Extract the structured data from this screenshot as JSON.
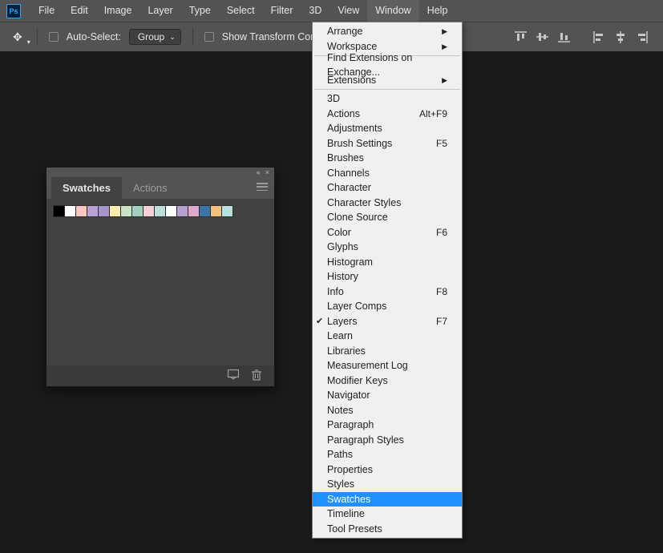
{
  "menubar": {
    "logo": "Ps",
    "items": [
      "File",
      "Edit",
      "Image",
      "Layer",
      "Type",
      "Select",
      "Filter",
      "3D",
      "View",
      "Window",
      "Help"
    ]
  },
  "optionsbar": {
    "auto_select_label": "Auto-Select:",
    "group_label": "Group",
    "show_transform_label": "Show Transform Contro"
  },
  "panel": {
    "collapse_glyph": "«",
    "close_glyph": "×",
    "tabs": [
      "Swatches",
      "Actions"
    ],
    "swatch_colors": [
      "#000000",
      "#ffffff",
      "#f7c7c0",
      "#b9a3d6",
      "#a694cf",
      "#fcecb0",
      "#c8e3c5",
      "#a2cfc2",
      "#f6cfd9",
      "#b8e0d6",
      "#ffffff",
      "#b6a0d3",
      "#dfa7c9",
      "#3b74a8",
      "#f1c27d",
      "#b5e2de"
    ]
  },
  "window_menu": {
    "items": [
      {
        "label": "Arrange",
        "submenu": true
      },
      {
        "label": "Workspace",
        "submenu": true
      },
      {
        "sep": true
      },
      {
        "label": "Find Extensions on Exchange..."
      },
      {
        "label": "Extensions",
        "submenu": true
      },
      {
        "sep": true
      },
      {
        "label": "3D"
      },
      {
        "label": "Actions",
        "shortcut": "Alt+F9"
      },
      {
        "label": "Adjustments"
      },
      {
        "label": "Brush Settings",
        "shortcut": "F5"
      },
      {
        "label": "Brushes"
      },
      {
        "label": "Channels"
      },
      {
        "label": "Character"
      },
      {
        "label": "Character Styles"
      },
      {
        "label": "Clone Source"
      },
      {
        "label": "Color",
        "shortcut": "F6"
      },
      {
        "label": "Glyphs"
      },
      {
        "label": "Histogram"
      },
      {
        "label": "History"
      },
      {
        "label": "Info",
        "shortcut": "F8"
      },
      {
        "label": "Layer Comps"
      },
      {
        "label": "Layers",
        "shortcut": "F7",
        "checked": true
      },
      {
        "label": "Learn"
      },
      {
        "label": "Libraries"
      },
      {
        "label": "Measurement Log"
      },
      {
        "label": "Modifier Keys"
      },
      {
        "label": "Navigator"
      },
      {
        "label": "Notes"
      },
      {
        "label": "Paragraph"
      },
      {
        "label": "Paragraph Styles"
      },
      {
        "label": "Paths"
      },
      {
        "label": "Properties"
      },
      {
        "label": "Styles"
      },
      {
        "label": "Swatches",
        "highlight": true
      },
      {
        "label": "Timeline"
      },
      {
        "label": "Tool Presets"
      }
    ]
  }
}
